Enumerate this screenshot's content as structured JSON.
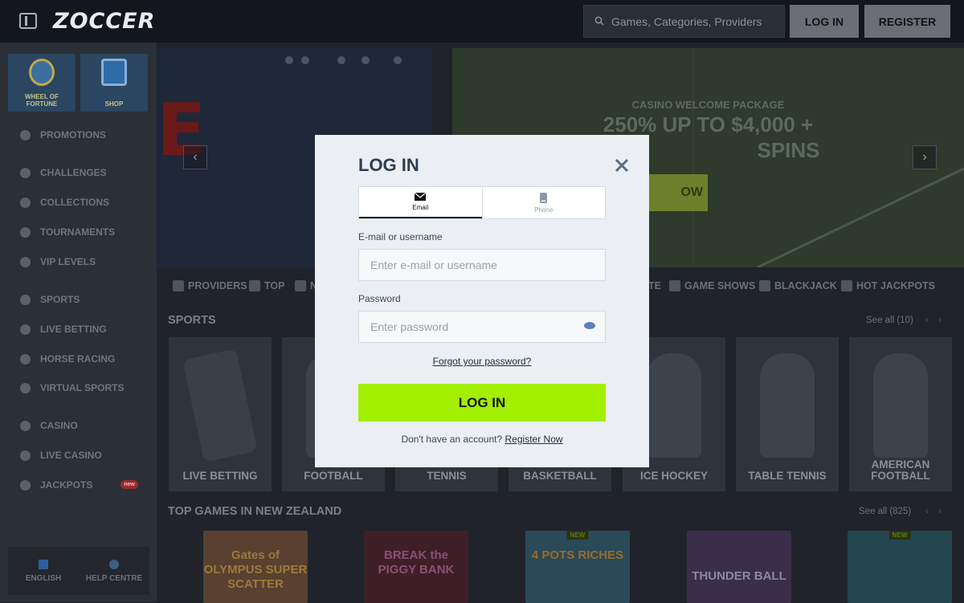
{
  "header": {
    "logo": "ZOCCER",
    "search_placeholder": "Games, Categories, Providers",
    "login_label": "LOG IN",
    "register_label": "REGISTER"
  },
  "sidebar": {
    "tiles": [
      {
        "label": "WHEEL OF FORTUNE",
        "icon": "wheel-icon"
      },
      {
        "label": "SHOP",
        "icon": "shop-icon"
      }
    ],
    "items": [
      {
        "label": "PROMOTIONS",
        "icon": "gift-icon"
      },
      {
        "label": "CHALLENGES",
        "icon": "medal-icon"
      },
      {
        "label": "COLLECTIONS",
        "icon": "cards-icon"
      },
      {
        "label": "TOURNAMENTS",
        "icon": "podium-icon"
      },
      {
        "label": "VIP LEVELS",
        "icon": "shield-icon"
      },
      {
        "label": "SPORTS",
        "icon": "ball-icon"
      },
      {
        "label": "LIVE BETTING",
        "icon": "tv-icon"
      },
      {
        "label": "HORSE RACING",
        "icon": "horse-icon"
      },
      {
        "label": "VIRTUAL SPORTS",
        "icon": "gamepad-icon"
      },
      {
        "label": "CASINO",
        "icon": "dice-icon"
      },
      {
        "label": "LIVE CASINO",
        "icon": "live-cards-icon"
      },
      {
        "label": "JACKPOTS",
        "icon": "horseshoe-icon",
        "badge": "new"
      }
    ],
    "bottom": {
      "language": "ENGLISH",
      "help": "HELP CENTRE"
    }
  },
  "banner": {
    "kicker": "CASINO WELCOME PACKAGE",
    "headline": "250% UP TO $4,000 +",
    "headline2": "SPINS",
    "cta": "OW"
  },
  "categories": [
    "PROVIDERS",
    "TOP",
    "N",
    "TE",
    "GAME SHOWS",
    "BLACKJACK",
    "HOT JACKPOTS"
  ],
  "sports_section": {
    "title": "SPORTS",
    "see_all": "See all (10)",
    "cards": [
      "LIVE BETTING",
      "FOOTBALL",
      "TENNIS",
      "BASKETBALL",
      "ICE HOCKEY",
      "TABLE TENNIS",
      "AMERICAN FOOTBALL"
    ]
  },
  "top_games_section": {
    "title": "TOP GAMES IN NEW ZEALAND",
    "see_all": "See all (825)",
    "games": [
      {
        "title": "Gates of OLYMPUS SUPER SCATTER",
        "new": ""
      },
      {
        "title": "BREAK the PIGGY BANK",
        "new": ""
      },
      {
        "title": "4 POTS RICHES",
        "new": "NEW"
      },
      {
        "title": "THUNDER BALL",
        "new": ""
      },
      {
        "title": "",
        "new": "NEW"
      }
    ]
  },
  "modal": {
    "title": "LOG IN",
    "tabs": [
      {
        "label": "Email",
        "icon": "envelope-icon"
      },
      {
        "label": "Phone",
        "icon": "phone-icon"
      }
    ],
    "email_label": "E-mail or username",
    "email_placeholder": "Enter e-mail or username",
    "password_label": "Password",
    "password_placeholder": "Enter password",
    "forgot": "Forgot your password?",
    "submit": "LOG IN",
    "no_account": "Don't have an account?",
    "register_now": "Register Now"
  }
}
